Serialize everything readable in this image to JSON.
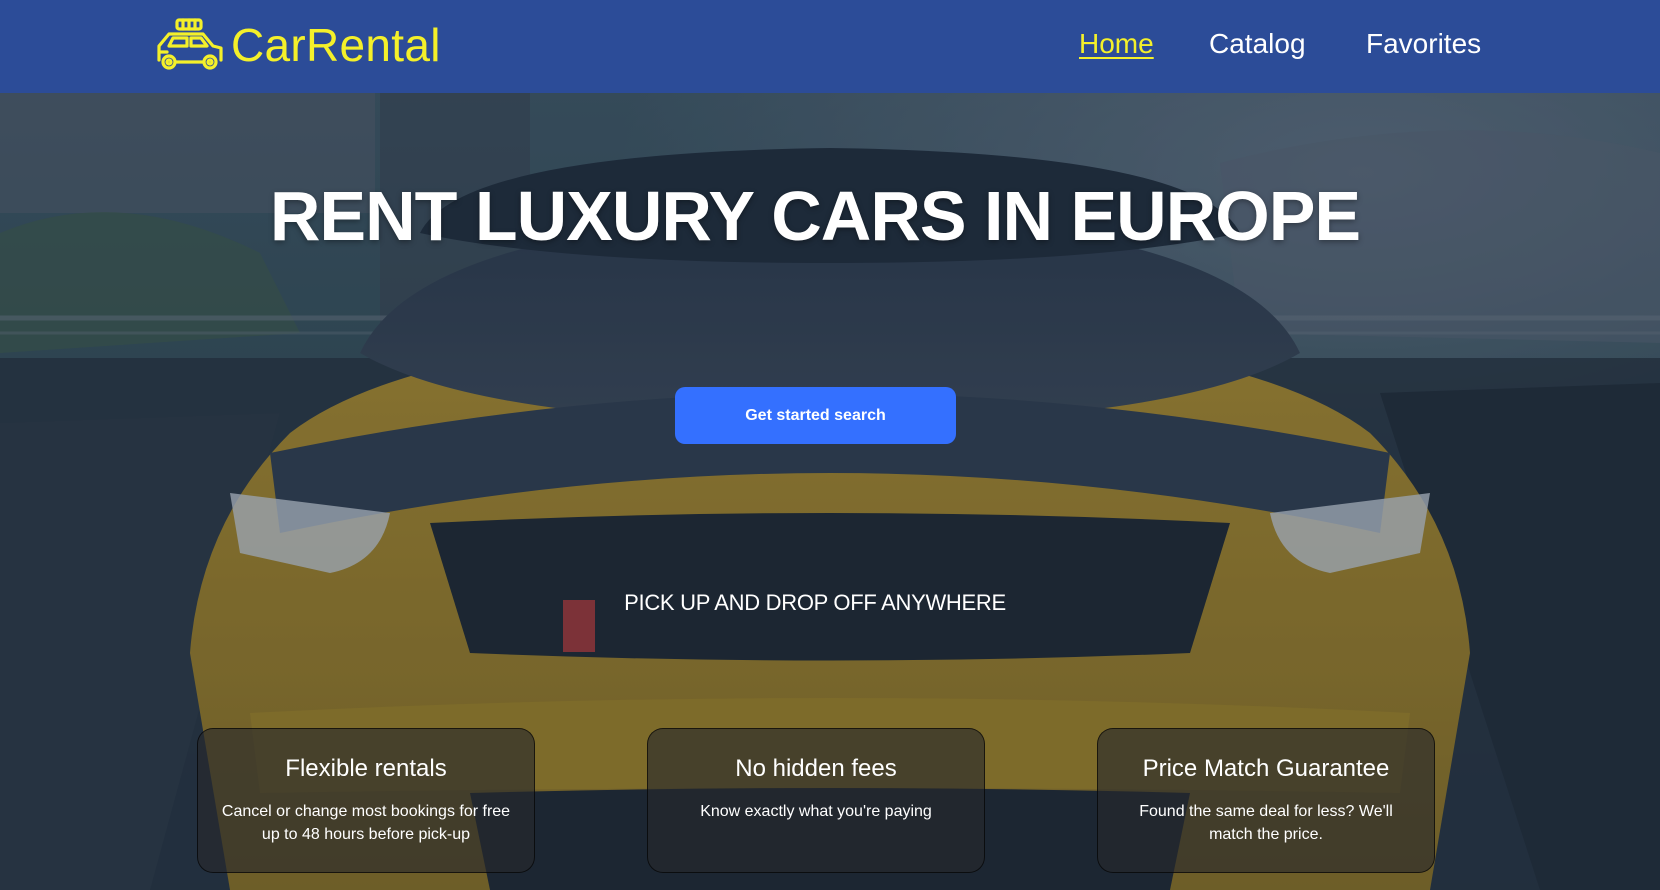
{
  "brand": {
    "name": "CarRental",
    "logo_icon": "car-icon",
    "color": "#f4f02a"
  },
  "nav": {
    "items": [
      {
        "label": "Home",
        "active": true
      },
      {
        "label": "Catalog",
        "active": false
      },
      {
        "label": "Favorites",
        "active": false
      }
    ]
  },
  "hero": {
    "title": "RENT LUXURY CARS IN EUROPE",
    "cta_label": "Get started search",
    "subtitle": "PICK UP AND DROP OFF ANYWHERE"
  },
  "features": [
    {
      "title": "Flexible rentals",
      "text": "Cancel or change most bookings for free up to 48 hours before pick-up"
    },
    {
      "title": "No hidden fees",
      "text": "Know exactly what you're paying"
    },
    {
      "title": "Price Match Guarantee",
      "text": "Found the same deal for less? We'll match the price."
    }
  ],
  "colors": {
    "header_bg": "#2c4c98",
    "accent": "#f4f02a",
    "button": "#3470ff"
  }
}
